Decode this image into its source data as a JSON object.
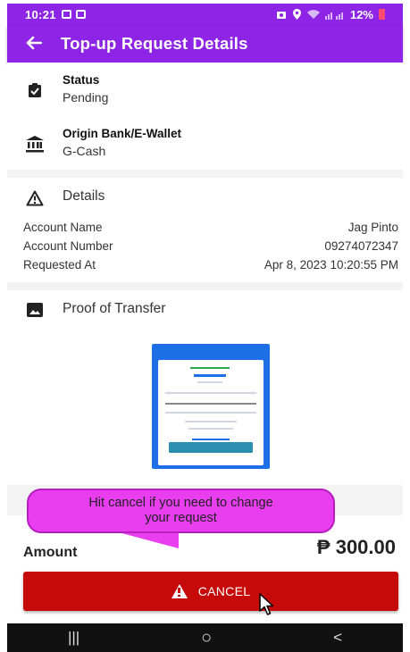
{
  "status_bar": {
    "time": "10:21",
    "battery": "12%"
  },
  "app_bar": {
    "back_icon": "arrow-left-icon",
    "title": "Top-up Request Details"
  },
  "status": {
    "icon": "clipboard-check-icon",
    "label": "Status",
    "value": "Pending"
  },
  "origin": {
    "icon": "bank-icon",
    "label": "Origin Bank/E-Wallet",
    "value": "G-Cash"
  },
  "details": {
    "icon": "warning-triangle-icon",
    "title": "Details",
    "rows": [
      {
        "key": "Account Name",
        "value": "Jag Pinto"
      },
      {
        "key": "Account Number",
        "value": "09274072347"
      },
      {
        "key": "Requested At",
        "value": "Apr 8, 2023 10:20:55 PM"
      }
    ]
  },
  "proof": {
    "icon": "image-icon",
    "title": "Proof of Transfer"
  },
  "tooltip": {
    "line1": "Hit cancel if you need to change",
    "line2": "your request"
  },
  "amount": {
    "label": "Amount",
    "value": "₱ 300.00"
  },
  "cancel_button": {
    "label": "CANCEL",
    "color": "#c60909"
  },
  "nav_bar": {
    "recent": "|||",
    "home": "○",
    "back": "<"
  },
  "colors": {
    "accent": "#8e24e6"
  }
}
